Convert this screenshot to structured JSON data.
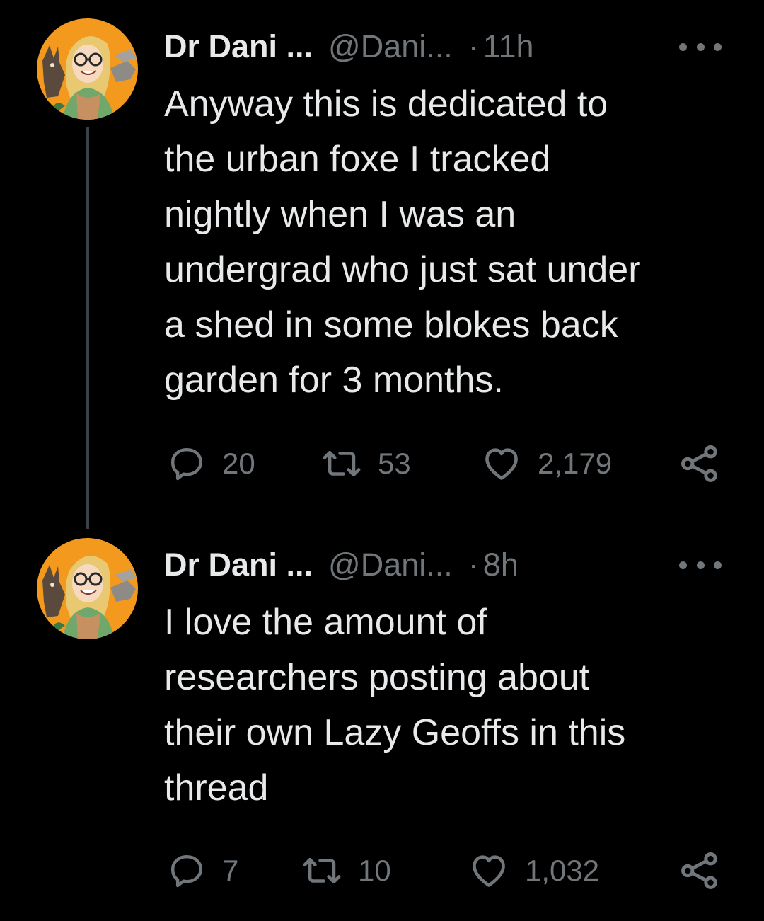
{
  "tweets": [
    {
      "display_name": "Dr Dani ...",
      "handle": "@Dani...",
      "separator": "·",
      "time": "11h",
      "text_lines": [
        "Anyway this is dedicated to",
        "the urban foxe I tracked",
        "nightly when I was an",
        "undergrad who just sat under",
        "a shed in some blokes back",
        "garden for 3 months."
      ],
      "replies": "20",
      "retweets": "53",
      "likes": "2,179"
    },
    {
      "display_name": "Dr Dani ...",
      "handle": "@Dani...",
      "separator": "·",
      "time": "8h",
      "text_lines": [
        "I love the amount of",
        "researchers posting about",
        "their own Lazy Geoffs in this",
        "thread"
      ],
      "replies": "7",
      "retweets": "10",
      "likes": "1,032"
    }
  ],
  "icons": {
    "reply": "reply-icon",
    "retweet": "retweet-icon",
    "like": "like-icon",
    "share": "share-icon",
    "more": "more-icon"
  },
  "colors": {
    "background": "#000000",
    "text_primary": "#E7E9EA",
    "text_secondary": "#71767B",
    "thread_line": "#3E4144",
    "avatar_bg": "#F39A1E"
  }
}
